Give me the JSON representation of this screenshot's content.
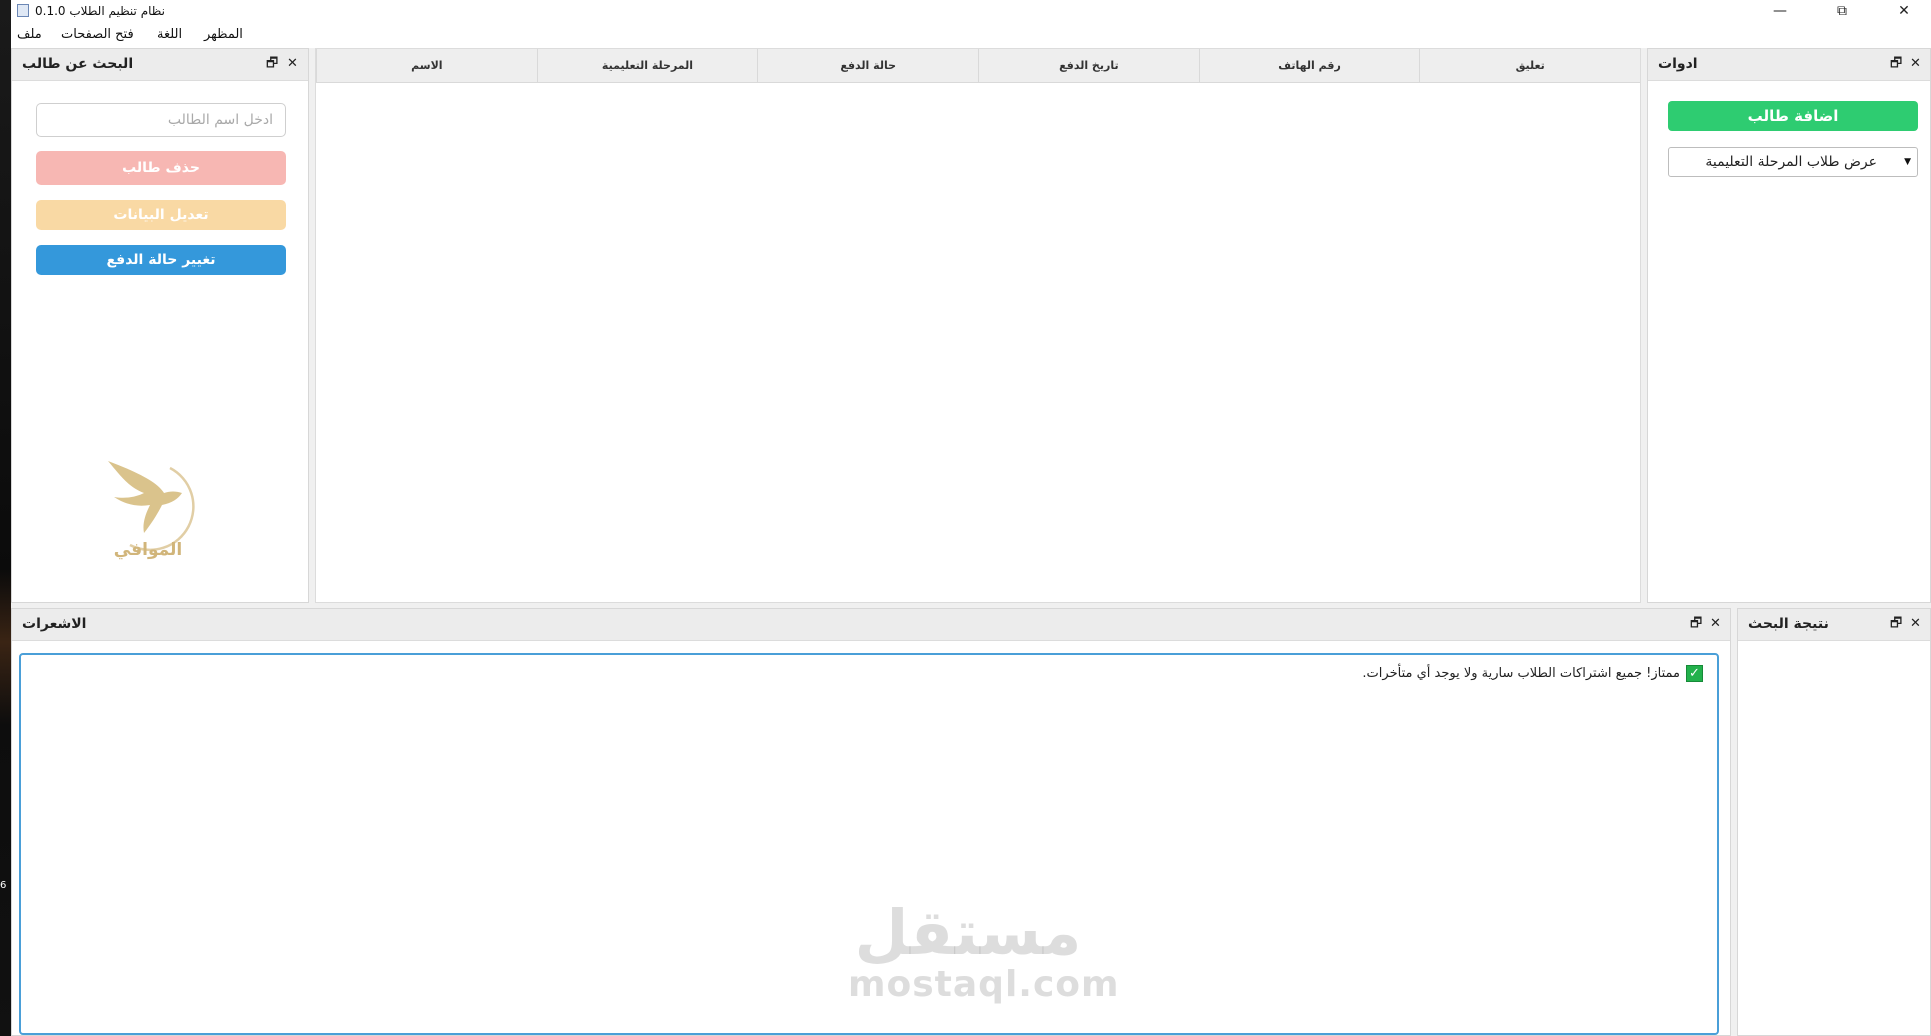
{
  "window": {
    "title": "نظام تنظيم الطلاب 0.1.0",
    "controls": {
      "minimize": "—",
      "restore": "⧉",
      "close": "✕"
    }
  },
  "desktop": {
    "stray_number": "6"
  },
  "menu": {
    "items": [
      {
        "label": "ملف"
      },
      {
        "label": "فتح الصفحات"
      },
      {
        "label": "اللغة"
      },
      {
        "label": "المظهر"
      }
    ]
  },
  "search_panel": {
    "title": "البحث عن طالب",
    "search_placeholder": "ادخل اسم الطالب",
    "buttons": {
      "delete": "حذف طالب",
      "edit": "تعديل البيانات",
      "change_payment": "تغيير حالة الدفع"
    },
    "logo_text": "الموافي",
    "colors": {
      "delete": "#f7b7b3",
      "edit": "#f9d9a4",
      "change_payment": "#3498db"
    }
  },
  "table": {
    "columns": [
      "الاسم",
      "المرحلة التعليمية",
      "حالة الدفع",
      "تاريخ الدفع",
      "رقم الهاتف",
      "تعليق"
    ]
  },
  "tools_panel": {
    "title": "ادوات",
    "add_button": "اضافة طالب",
    "filter_selected": "عرض طلاب المرحلة التعليمية",
    "colors": {
      "add": "#2ecc71"
    }
  },
  "notifications_panel": {
    "title": "الاشعرات",
    "messages": [
      {
        "icon": "check-icon",
        "text": "ممتاز! جميع اشتراكات الطلاب سارية ولا يوجد أي متأخرات."
      }
    ]
  },
  "results_panel": {
    "title": "نتيجة البحث"
  },
  "panel_buttons": {
    "float": "🗗",
    "close": "✕"
  },
  "watermark": {
    "arabic": "مستقل",
    "latin": "mostaql.com"
  }
}
